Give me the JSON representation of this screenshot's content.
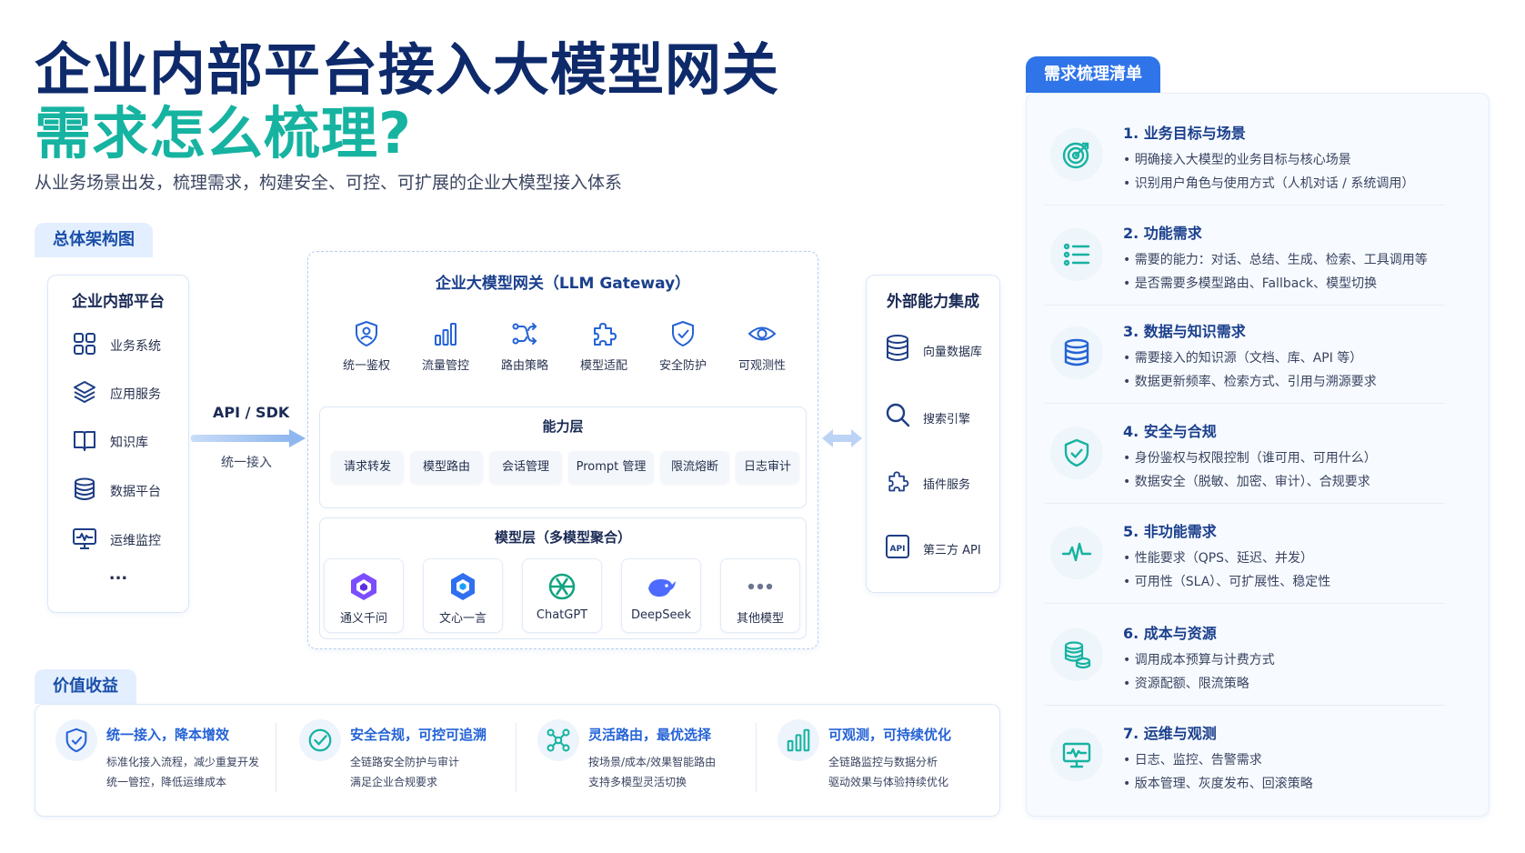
{
  "header": {
    "title_line1": "企业内部平台接入大模型网关",
    "title_line2": "需求怎么梳理?",
    "subtitle": "从业务场景出发，梳理需求，构建安全、可控、可扩展的企业大模型接入体系"
  },
  "architecture": {
    "tag": "总体架构图",
    "internal": {
      "title": "企业内部平台",
      "items": [
        "业务系统",
        "应用服务",
        "知识库",
        "数据平台",
        "运维监控"
      ],
      "more": "..."
    },
    "connector": {
      "label": "API / SDK",
      "sub": "统一接入"
    },
    "gateway": {
      "title": "企业大模型网关（LLM Gateway）",
      "features": [
        "统一鉴权",
        "流量管控",
        "路由策略",
        "模型适配",
        "安全防护",
        "可观测性"
      ],
      "capability_layer": {
        "title": "能力层",
        "chips": [
          "请求转发",
          "模型路由",
          "会话管理",
          "Prompt 管理",
          "限流熔断",
          "日志审计"
        ]
      },
      "model_layer": {
        "title": "模型层（多模型聚合）",
        "models": [
          "通义千问",
          "文心一言",
          "ChatGPT",
          "DeepSeek",
          "其他模型"
        ]
      }
    },
    "external": {
      "title": "外部能力集成",
      "items": [
        "向量数据库",
        "搜索引擎",
        "插件服务",
        "第三方 API"
      ]
    }
  },
  "value": {
    "tag": "价值收益",
    "items": [
      {
        "title": "统一接入，降本增效",
        "lines": [
          "标准化接入流程，减少重复开发",
          "统一管控，降低运维成本"
        ]
      },
      {
        "title": "安全合规，可控可追溯",
        "lines": [
          "全链路安全防护与审计",
          "满足企业合规要求"
        ]
      },
      {
        "title": "灵活路由，最优选择",
        "lines": [
          "按场景/成本/效果智能路由",
          "支持多模型灵活切换"
        ]
      },
      {
        "title": "可观测，可持续优化",
        "lines": [
          "全链路监控与数据分析",
          "驱动效果与体验持续优化"
        ]
      }
    ]
  },
  "checklist": {
    "tag": "需求梳理清单",
    "items": [
      {
        "title": "1. 业务目标与场景",
        "lines": [
          "• 明确接入大模型的业务目标与核心场景",
          "• 识别用户角色与使用方式（人机对话 / 系统调用）"
        ]
      },
      {
        "title": "2. 功能需求",
        "lines": [
          "• 需要的能力：对话、总结、生成、检索、工具调用等",
          "• 是否需要多模型路由、Fallback、模型切换"
        ]
      },
      {
        "title": "3. 数据与知识需求",
        "lines": [
          "• 需要接入的知识源（文档、库、API 等）",
          "• 数据更新频率、检索方式、引用与溯源要求"
        ]
      },
      {
        "title": "4. 安全与合规",
        "lines": [
          "• 身份鉴权与权限控制（谁可用、可用什么）",
          "• 数据安全（脱敏、加密、审计）、合规要求"
        ]
      },
      {
        "title": "5. 非功能需求",
        "lines": [
          "• 性能要求（QPS、延迟、并发）",
          "• 可用性（SLA）、可扩展性、稳定性"
        ]
      },
      {
        "title": "6. 成本与资源",
        "lines": [
          "• 调用成本预算与计费方式",
          "• 资源配额、限流策略"
        ]
      },
      {
        "title": "7. 运维与观测",
        "lines": [
          "• 日志、监控、告警需求",
          "• 版本管理、灰度发布、回滚策略"
        ]
      }
    ]
  },
  "colors": {
    "navy": "#0e2a6b",
    "teal": "#16b3a1",
    "blue": "#2563d6",
    "accent_tag": "#2f74e8"
  }
}
